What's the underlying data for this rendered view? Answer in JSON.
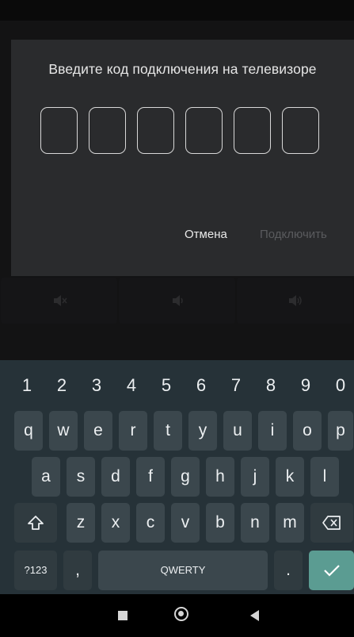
{
  "dialog": {
    "title": "Введите код подключения на телевизоре",
    "code_digits": [
      "",
      "",
      "",
      "",
      "",
      ""
    ],
    "cancel_label": "Отмена",
    "connect_label": "Подключить"
  },
  "background_controls": [
    {
      "icon": "mute-icon"
    },
    {
      "icon": "volume-down-icon"
    },
    {
      "icon": "volume-up-icon"
    }
  ],
  "keyboard": {
    "numbers": [
      "1",
      "2",
      "3",
      "4",
      "5",
      "6",
      "7",
      "8",
      "9",
      "0"
    ],
    "row1": [
      "q",
      "w",
      "e",
      "r",
      "t",
      "y",
      "u",
      "i",
      "o",
      "p"
    ],
    "row2": [
      "a",
      "s",
      "d",
      "f",
      "g",
      "h",
      "j",
      "k",
      "l"
    ],
    "row3": [
      "z",
      "x",
      "c",
      "v",
      "b",
      "n",
      "m"
    ],
    "symbols_label": "?123",
    "comma_label": ",",
    "space_label": "QWERTY",
    "period_label": ".",
    "shift_icon": "shift-icon",
    "backspace_icon": "backspace-icon",
    "enter_icon": "checkmark-icon",
    "colors": {
      "background": "#263238",
      "key": "#3b474d",
      "accent": "#5b9c92"
    }
  },
  "nav": {
    "icons": [
      "recents-icon",
      "home-icon",
      "back-icon"
    ]
  }
}
